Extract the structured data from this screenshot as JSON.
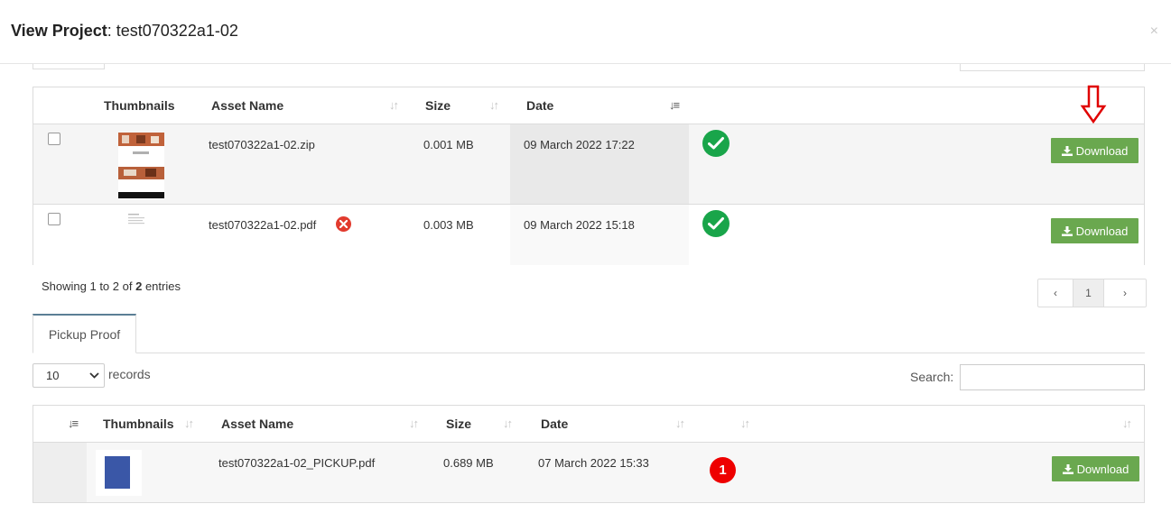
{
  "modal": {
    "title_label": "View Project",
    "title_separator": ":",
    "title_value": "test070322a1-02",
    "close_glyph": "×"
  },
  "assets_table": {
    "headers": {
      "thumbnails": "Thumbnails",
      "asset_name": "Asset Name",
      "size": "Size",
      "date": "Date"
    },
    "rows": [
      {
        "name": "test070322a1-02.zip",
        "size": "0.001 MB",
        "date": "09 March 2022 17:22",
        "status_icon": "check-circle-icon",
        "action": "Download",
        "has_error_icon": false
      },
      {
        "name": "test070322a1-02.pdf",
        "size": "0.003 MB",
        "date": "09 March 2022 15:18",
        "status_icon": "check-circle-icon",
        "action": "Download",
        "has_error_icon": true
      }
    ],
    "showing_prefix": "Showing 1 to 2 of",
    "showing_total": "2",
    "showing_suffix": "entries",
    "pagination": {
      "prev": "‹",
      "current": "1",
      "next": "›"
    }
  },
  "tabs": [
    {
      "label": "Pickup Proof",
      "active": true
    }
  ],
  "pickup_controls": {
    "records_select_value": "10",
    "records_label": "records",
    "search_label": "Search:",
    "search_value": ""
  },
  "pickup_table": {
    "headers": {
      "thumbnails": "Thumbnails",
      "asset_name": "Asset Name",
      "size": "Size",
      "date": "Date"
    },
    "rows": [
      {
        "name": "test070322a1-02_PICKUP.pdf",
        "size": "0.689 MB",
        "date": "07 March 2022 15:33",
        "badge": "1",
        "action": "Download"
      }
    ]
  },
  "colors": {
    "download_green": "#6aa84f",
    "check_green": "#19a54a",
    "error_red": "#e23b2e",
    "badge_red": "#ee0000",
    "annotation_arrow_red": "#e00000",
    "tab_accent": "#5b7f95"
  }
}
